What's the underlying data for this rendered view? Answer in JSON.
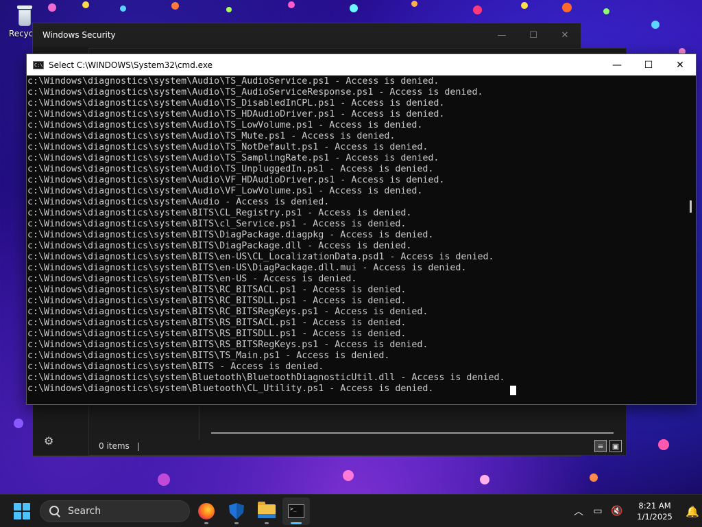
{
  "desktop": {
    "recycle_bin_label": "Recycle"
  },
  "security_window": {
    "title": "Windows Security",
    "minimize_glyph": "—",
    "maximize_glyph": "☐",
    "close_glyph": "✕",
    "settings_icon": "⚙",
    "status_text": "0 items"
  },
  "cmd_window": {
    "title": "Select C:\\WINDOWS\\System32\\cmd.exe",
    "icon_text": "C:\\",
    "minimize_glyph": "—",
    "maximize_glyph": "☐",
    "close_glyph": "✕",
    "lines": [
      "c:\\Windows\\diagnostics\\system\\Audio\\TS_AudioService.ps1 - Access is denied.",
      "c:\\Windows\\diagnostics\\system\\Audio\\TS_AudioServiceResponse.ps1 - Access is denied.",
      "c:\\Windows\\diagnostics\\system\\Audio\\TS_DisabledInCPL.ps1 - Access is denied.",
      "c:\\Windows\\diagnostics\\system\\Audio\\TS_HDAudioDriver.ps1 - Access is denied.",
      "c:\\Windows\\diagnostics\\system\\Audio\\TS_LowVolume.ps1 - Access is denied.",
      "c:\\Windows\\diagnostics\\system\\Audio\\TS_Mute.ps1 - Access is denied.",
      "c:\\Windows\\diagnostics\\system\\Audio\\TS_NotDefault.ps1 - Access is denied.",
      "c:\\Windows\\diagnostics\\system\\Audio\\TS_SamplingRate.ps1 - Access is denied.",
      "c:\\Windows\\diagnostics\\system\\Audio\\TS_UnpluggedIn.ps1 - Access is denied.",
      "c:\\Windows\\diagnostics\\system\\Audio\\VF_HDAudioDriver.ps1 - Access is denied.",
      "c:\\Windows\\diagnostics\\system\\Audio\\VF_LowVolume.ps1 - Access is denied.",
      "c:\\Windows\\diagnostics\\system\\Audio - Access is denied.",
      "c:\\Windows\\diagnostics\\system\\BITS\\CL_Registry.ps1 - Access is denied.",
      "c:\\Windows\\diagnostics\\system\\BITS\\cl_Service.ps1 - Access is denied.",
      "c:\\Windows\\diagnostics\\system\\BITS\\DiagPackage.diagpkg - Access is denied.",
      "c:\\Windows\\diagnostics\\system\\BITS\\DiagPackage.dll - Access is denied.",
      "c:\\Windows\\diagnostics\\system\\BITS\\en-US\\CL_LocalizationData.psd1 - Access is denied.",
      "c:\\Windows\\diagnostics\\system\\BITS\\en-US\\DiagPackage.dll.mui - Access is denied.",
      "c:\\Windows\\diagnostics\\system\\BITS\\en-US - Access is denied.",
      "c:\\Windows\\diagnostics\\system\\BITS\\RC_BITSACL.ps1 - Access is denied.",
      "c:\\Windows\\diagnostics\\system\\BITS\\RC_BITSDLL.ps1 - Access is denied.",
      "c:\\Windows\\diagnostics\\system\\BITS\\RC_BITSRegKeys.ps1 - Access is denied.",
      "c:\\Windows\\diagnostics\\system\\BITS\\RS_BITSACL.ps1 - Access is denied.",
      "c:\\Windows\\diagnostics\\system\\BITS\\RS_BITSDLL.ps1 - Access is denied.",
      "c:\\Windows\\diagnostics\\system\\BITS\\RS_BITSRegKeys.ps1 - Access is denied.",
      "c:\\Windows\\diagnostics\\system\\BITS\\TS_Main.ps1 - Access is denied.",
      "c:\\Windows\\diagnostics\\system\\BITS - Access is denied.",
      "c:\\Windows\\diagnostics\\system\\Bluetooth\\BluetoothDiagnosticUtil.dll - Access is denied.",
      "c:\\Windows\\diagnostics\\system\\Bluetooth\\CL_Utility.ps1 - Access is denied."
    ]
  },
  "taskbar": {
    "search_label": "Search",
    "apps": [
      {
        "name": "firefox-icon",
        "active": false
      },
      {
        "name": "windows-security-icon",
        "active": false
      },
      {
        "name": "file-explorer-icon",
        "active": false
      },
      {
        "name": "terminal-icon",
        "active": true
      }
    ],
    "tray": {
      "chevron_glyph": "︿",
      "network_glyph": "▭",
      "volume_glyph": "🔇",
      "time": "8:21 AM",
      "date": "1/1/2025",
      "bell_glyph": "🔔"
    }
  },
  "colors": {
    "accent": "#4cc2ff",
    "cmd_text": "#cccccc",
    "cmd_bg": "#0c0c0c"
  }
}
